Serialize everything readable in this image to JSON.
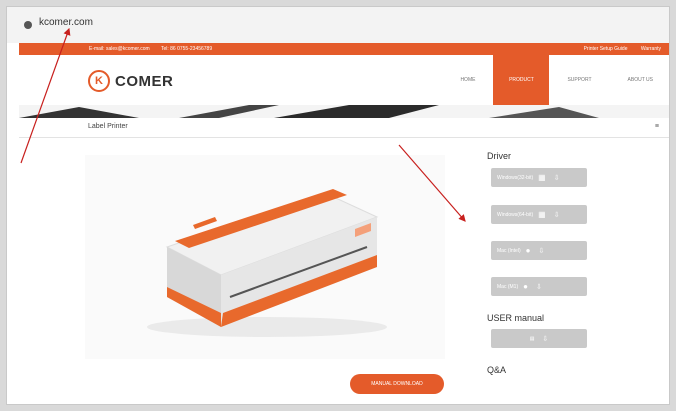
{
  "browser": {
    "url": "kcomer.com"
  },
  "topbar": {
    "email": "E-mail: sales@kcomer.com",
    "tel": "Tel: 86 0755-23456789",
    "links": [
      "Printer Setup Guide",
      "Warranty"
    ]
  },
  "brand": {
    "logo_mark": "K",
    "name": "COMER"
  },
  "nav": [
    "HOME",
    "PRODUCT",
    "SUPPORT",
    "ABOUT US"
  ],
  "active_nav": "PRODUCT",
  "breadcrumb": {
    "title": "Label Printer",
    "icon": "≡"
  },
  "driver": {
    "title": "Driver",
    "buttons": [
      "Windows(32-bit)",
      "Windows(64-bit)",
      "Mac (Intel)",
      "Mac (M1)"
    ]
  },
  "user_manual": {
    "title": "USER manual"
  },
  "qna": {
    "title": "Q&A"
  },
  "manual_button": "MANUAL DOWNLOAD",
  "colors": {
    "accent": "#e45b2a",
    "button_grey": "#c9c9c9"
  }
}
